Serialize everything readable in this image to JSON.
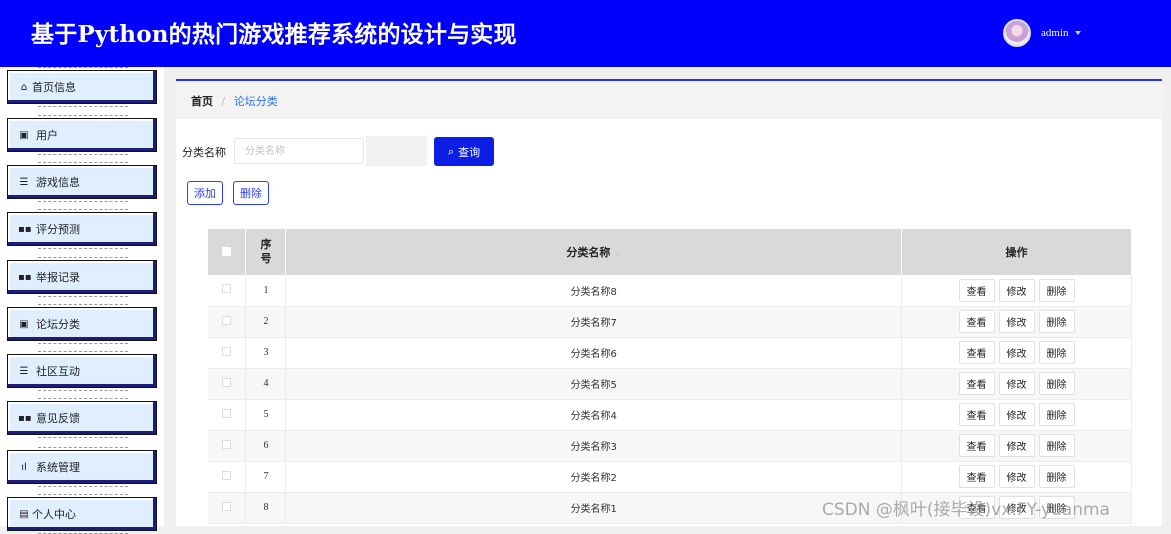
{
  "header": {
    "title": "基于Python的热门游戏推荐系统的设计与实现",
    "username": "admin"
  },
  "sidebar": {
    "items": [
      {
        "label": "首页信息",
        "icon": "home-icon",
        "glyph": "⌂"
      },
      {
        "label": "用户",
        "icon": "user-icon",
        "glyph": "▣"
      },
      {
        "label": "游戏信息",
        "icon": "list-icon",
        "glyph": "☰"
      },
      {
        "label": "评分预测",
        "icon": "grid-icon",
        "glyph": "▪▪"
      },
      {
        "label": "举报记录",
        "icon": "grid-icon",
        "glyph": "▪▪"
      },
      {
        "label": "论坛分类",
        "icon": "clipboard-icon",
        "glyph": "▣"
      },
      {
        "label": "社区互动",
        "icon": "list-icon",
        "glyph": "☰"
      },
      {
        "label": "意见反馈",
        "icon": "grid-icon",
        "glyph": "▪▪"
      },
      {
        "label": "系统管理",
        "icon": "bar-chart-icon",
        "glyph": "ıl"
      },
      {
        "label": "个人中心",
        "icon": "profile-icon",
        "glyph": "▤"
      }
    ]
  },
  "breadcrumb": {
    "home": "首页",
    "separator": "/",
    "current": "论坛分类"
  },
  "search": {
    "label": "分类名称",
    "placeholder": "分类名称",
    "query_label": "查询"
  },
  "actions": {
    "add_label": "添加",
    "delete_label": "删除"
  },
  "table": {
    "headers": {
      "index": "序号",
      "name": "分类名称",
      "ops": "操作"
    },
    "row_actions": {
      "view": "查看",
      "edit": "修改",
      "delete": "删除"
    },
    "rows": [
      {
        "index": "1",
        "name": "分类名称8"
      },
      {
        "index": "2",
        "name": "分类名称7"
      },
      {
        "index": "3",
        "name": "分类名称6"
      },
      {
        "index": "4",
        "name": "分类名称5"
      },
      {
        "index": "5",
        "name": "分类名称4"
      },
      {
        "index": "6",
        "name": "分类名称3"
      },
      {
        "index": "7",
        "name": "分类名称2"
      },
      {
        "index": "8",
        "name": "分类名称1"
      }
    ]
  },
  "watermark": "CSDN @枫叶(接毕设)vx:FY-yuanma",
  "colors": {
    "header_bg": "#0000ff",
    "primary": "#0d1fe6",
    "link": "#2b72e8"
  }
}
